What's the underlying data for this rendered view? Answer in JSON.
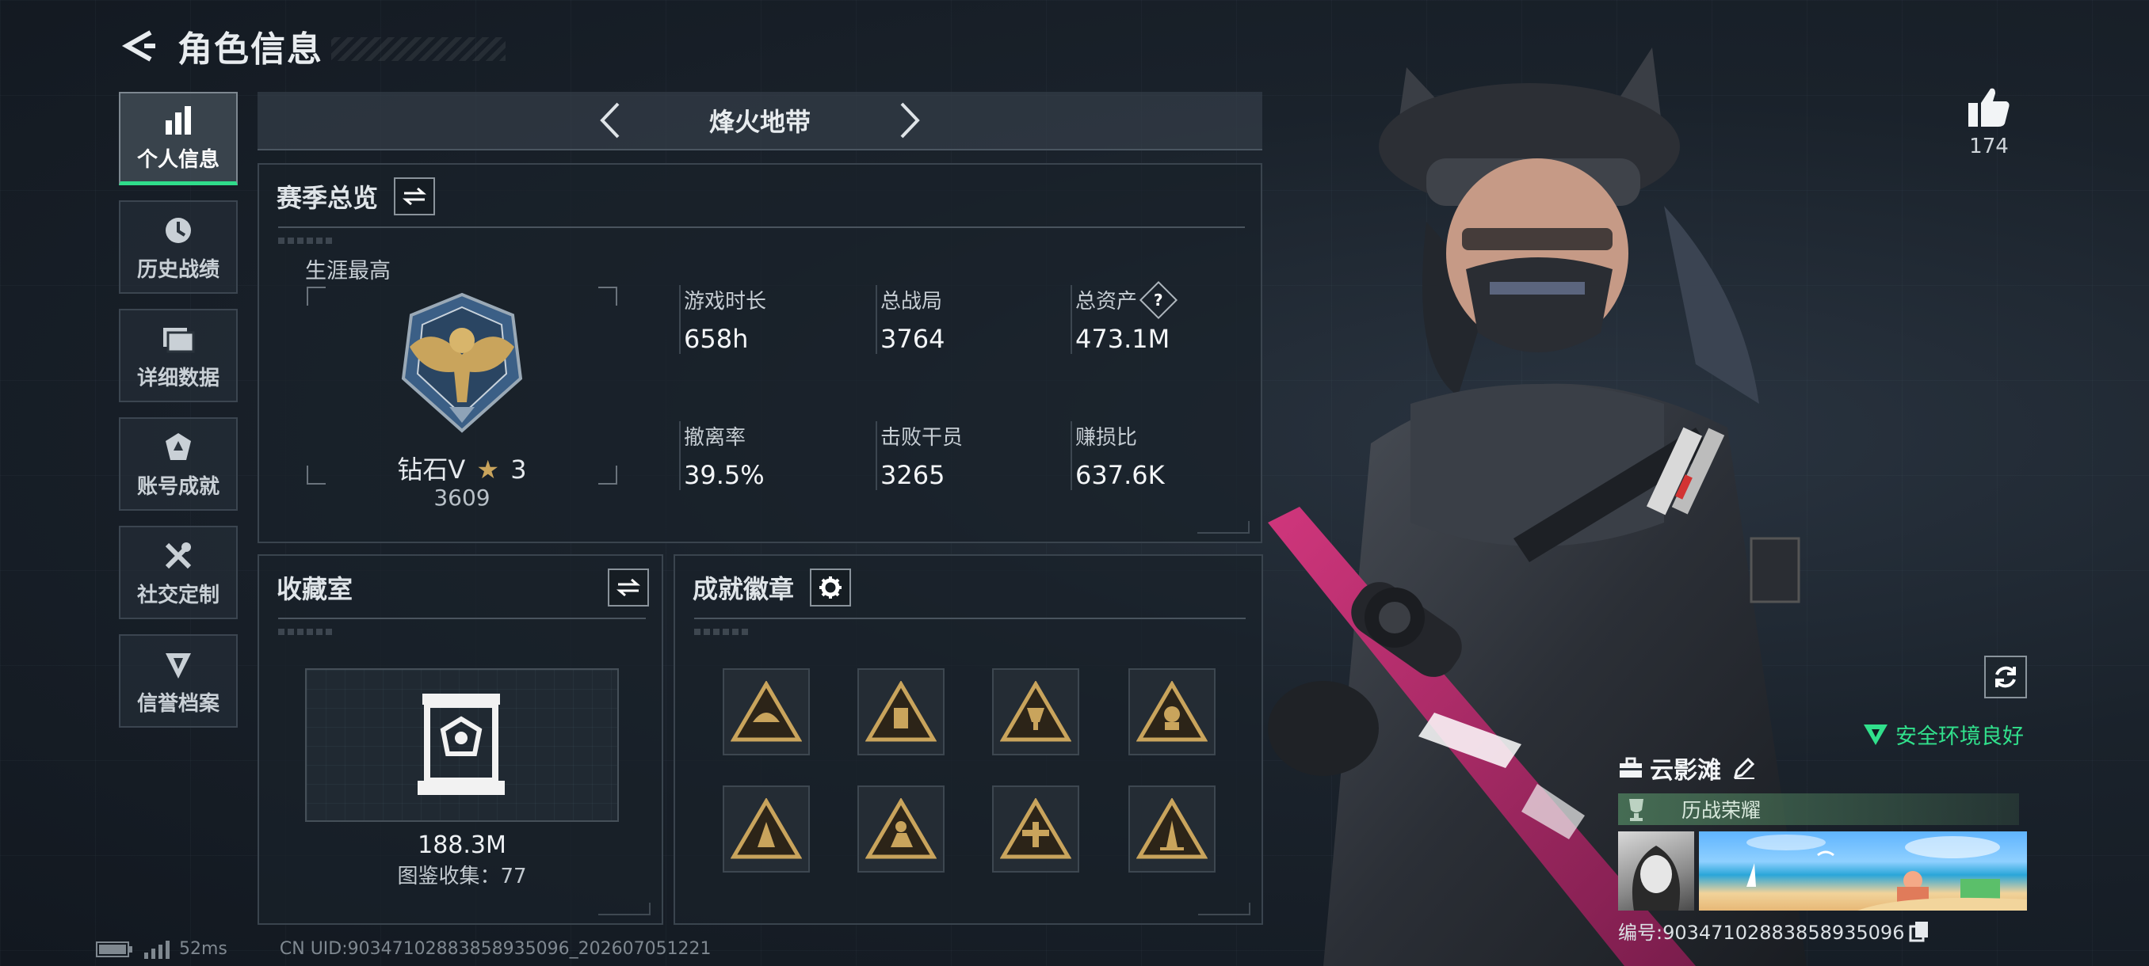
{
  "header": {
    "title": "角色信息"
  },
  "sidebar": {
    "items": [
      {
        "label": "个人信息",
        "icon": "bar-chart-icon",
        "active": true
      },
      {
        "label": "历史战绩",
        "icon": "history-clock-icon",
        "active": false
      },
      {
        "label": "详细数据",
        "icon": "folder-icon",
        "active": false
      },
      {
        "label": "账号成就",
        "icon": "achievement-icon",
        "active": false
      },
      {
        "label": "社交定制",
        "icon": "tools-icon",
        "active": false
      },
      {
        "label": "信誉档案",
        "icon": "credit-shield-icon",
        "active": false
      }
    ]
  },
  "mode": {
    "title": "烽火地带"
  },
  "season": {
    "title": "赛季总览",
    "career_label": "生涯最高",
    "rank_name": "钻石V",
    "rank_stars": "3",
    "rank_score": "3609",
    "stats": [
      {
        "label": "游戏时长",
        "value": "658h"
      },
      {
        "label": "总战局",
        "value": "3764"
      },
      {
        "label": "总资产",
        "value": "473.1M",
        "help": "?"
      },
      {
        "label": "撤离率",
        "value": "39.5%"
      },
      {
        "label": "击败干员",
        "value": "3265"
      },
      {
        "label": "赚损比",
        "value": "637.6K"
      }
    ]
  },
  "collection": {
    "title": "收藏室",
    "value": "188.3M",
    "count_text": "图鉴收集：77"
  },
  "achievements": {
    "title": "成就徽章",
    "badges": [
      "badge-1",
      "badge-2",
      "badge-3",
      "badge-4",
      "badge-5",
      "badge-6",
      "badge-7",
      "badge-8"
    ]
  },
  "like": {
    "count": "174"
  },
  "player": {
    "safe_env": "安全环境良好",
    "name": "云影滩",
    "honor": "历战荣耀",
    "id_text": "编号:90347102883858935096"
  },
  "status": {
    "ping": "52ms",
    "uid": "CN UID:90347102883858935096_202607051221"
  },
  "colors": {
    "accent_green": "#2fdc8a",
    "badge_gold": "#c9a45c"
  }
}
